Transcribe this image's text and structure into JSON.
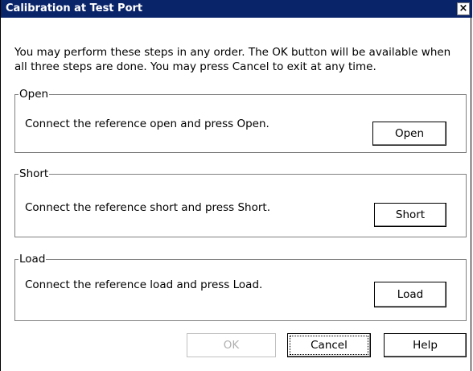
{
  "dialog": {
    "title": "Calibration at Test Port",
    "close_symbol": "×",
    "intro_text": "You may perform these steps in any order. The OK button will be available when all three steps are done. You may press Cancel to exit at any time."
  },
  "groups": {
    "open": {
      "legend": "Open",
      "instruction": "Connect the reference open and press Open.",
      "button_label": "Open"
    },
    "short": {
      "legend": "Short",
      "instruction": "Connect the reference short and press Short.",
      "button_label": "Short"
    },
    "load": {
      "legend": "Load",
      "instruction": "Connect the reference load and press Load.",
      "button_label": "Load"
    }
  },
  "footer": {
    "ok_label": "OK",
    "ok_enabled": false,
    "cancel_label": "Cancel",
    "help_label": "Help"
  },
  "colors": {
    "titlebar": "#0a246a",
    "title_text": "#ffffff",
    "disabled_text": "#b0b0b0"
  }
}
